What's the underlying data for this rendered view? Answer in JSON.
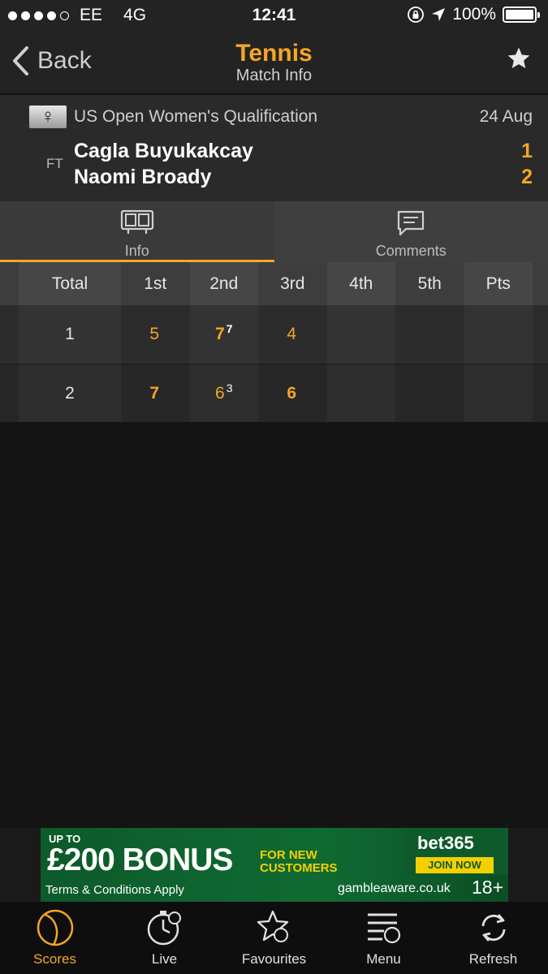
{
  "status": {
    "carrier": "EE",
    "network": "4G",
    "time": "12:41",
    "battery": "100%",
    "signal_bars": 4,
    "signal_total": 5
  },
  "nav": {
    "back_label": "Back",
    "title": "Tennis",
    "subtitle": "Match Info",
    "favourite_icon": "star-icon"
  },
  "match": {
    "competition": "US Open Women's Qualification",
    "gender_icon": "♀",
    "date": "24 Aug",
    "status": "FT",
    "players": [
      {
        "name": "Cagla Buyukakcay",
        "score": "1"
      },
      {
        "name": "Naomi Broady",
        "score": "2"
      }
    ]
  },
  "tabs": [
    {
      "label": "Info",
      "icon": "scoreboard-icon",
      "active": true
    },
    {
      "label": "Comments",
      "icon": "comment-icon",
      "active": false
    }
  ],
  "score_table": {
    "headers": [
      "Total",
      "1st",
      "2nd",
      "3rd",
      "4th",
      "5th",
      "Pts"
    ],
    "rows": [
      {
        "total": "1",
        "sets": [
          {
            "value": "5",
            "tiebreak": "",
            "won": false
          },
          {
            "value": "7",
            "tiebreak": "7",
            "won": true
          },
          {
            "value": "4",
            "tiebreak": "",
            "won": false
          },
          {
            "value": "",
            "tiebreak": "",
            "won": false
          },
          {
            "value": "",
            "tiebreak": "",
            "won": false
          }
        ],
        "pts": ""
      },
      {
        "total": "2",
        "sets": [
          {
            "value": "7",
            "tiebreak": "",
            "won": true
          },
          {
            "value": "6",
            "tiebreak": "3",
            "won": false
          },
          {
            "value": "6",
            "tiebreak": "",
            "won": true
          },
          {
            "value": "",
            "tiebreak": "",
            "won": false
          },
          {
            "value": "",
            "tiebreak": "",
            "won": false
          }
        ],
        "pts": ""
      }
    ]
  },
  "ad": {
    "up_to": "UP TO",
    "bonus": "£200 BONUS",
    "for_new_1": "FOR NEW",
    "for_new_2": "CUSTOMERS",
    "brand": "bet365",
    "cta": "JOIN NOW",
    "terms": "Terms & Conditions Apply",
    "gamble": "gambleaware.co.uk",
    "age": "18+"
  },
  "bottom_tabs": [
    {
      "label": "Scores",
      "icon": "tennis-ball-icon",
      "active": true
    },
    {
      "label": "Live",
      "icon": "live-stopwatch-icon",
      "active": false
    },
    {
      "label": "Favourites",
      "icon": "favourites-star-icon",
      "active": false
    },
    {
      "label": "Menu",
      "icon": "menu-icon",
      "active": false
    },
    {
      "label": "Refresh",
      "icon": "refresh-icon",
      "active": false
    }
  ],
  "colors": {
    "accent": "#f5a623",
    "background": "#141414",
    "header": "#232323"
  }
}
